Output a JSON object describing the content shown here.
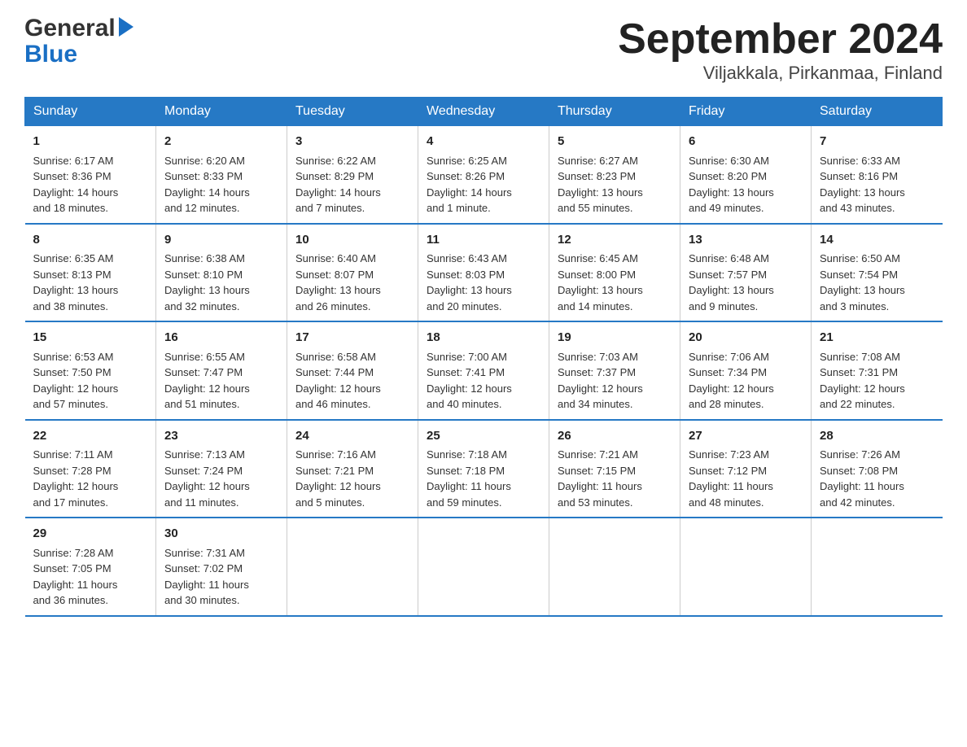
{
  "logo": {
    "part1": "General",
    "part2": "Blue"
  },
  "title": "September 2024",
  "subtitle": "Viljakkala, Pirkanmaa, Finland",
  "days": [
    "Sunday",
    "Monday",
    "Tuesday",
    "Wednesday",
    "Thursday",
    "Friday",
    "Saturday"
  ],
  "weeks": [
    [
      {
        "num": "1",
        "info": "Sunrise: 6:17 AM\nSunset: 8:36 PM\nDaylight: 14 hours\nand 18 minutes."
      },
      {
        "num": "2",
        "info": "Sunrise: 6:20 AM\nSunset: 8:33 PM\nDaylight: 14 hours\nand 12 minutes."
      },
      {
        "num": "3",
        "info": "Sunrise: 6:22 AM\nSunset: 8:29 PM\nDaylight: 14 hours\nand 7 minutes."
      },
      {
        "num": "4",
        "info": "Sunrise: 6:25 AM\nSunset: 8:26 PM\nDaylight: 14 hours\nand 1 minute."
      },
      {
        "num": "5",
        "info": "Sunrise: 6:27 AM\nSunset: 8:23 PM\nDaylight: 13 hours\nand 55 minutes."
      },
      {
        "num": "6",
        "info": "Sunrise: 6:30 AM\nSunset: 8:20 PM\nDaylight: 13 hours\nand 49 minutes."
      },
      {
        "num": "7",
        "info": "Sunrise: 6:33 AM\nSunset: 8:16 PM\nDaylight: 13 hours\nand 43 minutes."
      }
    ],
    [
      {
        "num": "8",
        "info": "Sunrise: 6:35 AM\nSunset: 8:13 PM\nDaylight: 13 hours\nand 38 minutes."
      },
      {
        "num": "9",
        "info": "Sunrise: 6:38 AM\nSunset: 8:10 PM\nDaylight: 13 hours\nand 32 minutes."
      },
      {
        "num": "10",
        "info": "Sunrise: 6:40 AM\nSunset: 8:07 PM\nDaylight: 13 hours\nand 26 minutes."
      },
      {
        "num": "11",
        "info": "Sunrise: 6:43 AM\nSunset: 8:03 PM\nDaylight: 13 hours\nand 20 minutes."
      },
      {
        "num": "12",
        "info": "Sunrise: 6:45 AM\nSunset: 8:00 PM\nDaylight: 13 hours\nand 14 minutes."
      },
      {
        "num": "13",
        "info": "Sunrise: 6:48 AM\nSunset: 7:57 PM\nDaylight: 13 hours\nand 9 minutes."
      },
      {
        "num": "14",
        "info": "Sunrise: 6:50 AM\nSunset: 7:54 PM\nDaylight: 13 hours\nand 3 minutes."
      }
    ],
    [
      {
        "num": "15",
        "info": "Sunrise: 6:53 AM\nSunset: 7:50 PM\nDaylight: 12 hours\nand 57 minutes."
      },
      {
        "num": "16",
        "info": "Sunrise: 6:55 AM\nSunset: 7:47 PM\nDaylight: 12 hours\nand 51 minutes."
      },
      {
        "num": "17",
        "info": "Sunrise: 6:58 AM\nSunset: 7:44 PM\nDaylight: 12 hours\nand 46 minutes."
      },
      {
        "num": "18",
        "info": "Sunrise: 7:00 AM\nSunset: 7:41 PM\nDaylight: 12 hours\nand 40 minutes."
      },
      {
        "num": "19",
        "info": "Sunrise: 7:03 AM\nSunset: 7:37 PM\nDaylight: 12 hours\nand 34 minutes."
      },
      {
        "num": "20",
        "info": "Sunrise: 7:06 AM\nSunset: 7:34 PM\nDaylight: 12 hours\nand 28 minutes."
      },
      {
        "num": "21",
        "info": "Sunrise: 7:08 AM\nSunset: 7:31 PM\nDaylight: 12 hours\nand 22 minutes."
      }
    ],
    [
      {
        "num": "22",
        "info": "Sunrise: 7:11 AM\nSunset: 7:28 PM\nDaylight: 12 hours\nand 17 minutes."
      },
      {
        "num": "23",
        "info": "Sunrise: 7:13 AM\nSunset: 7:24 PM\nDaylight: 12 hours\nand 11 minutes."
      },
      {
        "num": "24",
        "info": "Sunrise: 7:16 AM\nSunset: 7:21 PM\nDaylight: 12 hours\nand 5 minutes."
      },
      {
        "num": "25",
        "info": "Sunrise: 7:18 AM\nSunset: 7:18 PM\nDaylight: 11 hours\nand 59 minutes."
      },
      {
        "num": "26",
        "info": "Sunrise: 7:21 AM\nSunset: 7:15 PM\nDaylight: 11 hours\nand 53 minutes."
      },
      {
        "num": "27",
        "info": "Sunrise: 7:23 AM\nSunset: 7:12 PM\nDaylight: 11 hours\nand 48 minutes."
      },
      {
        "num": "28",
        "info": "Sunrise: 7:26 AM\nSunset: 7:08 PM\nDaylight: 11 hours\nand 42 minutes."
      }
    ],
    [
      {
        "num": "29",
        "info": "Sunrise: 7:28 AM\nSunset: 7:05 PM\nDaylight: 11 hours\nand 36 minutes."
      },
      {
        "num": "30",
        "info": "Sunrise: 7:31 AM\nSunset: 7:02 PM\nDaylight: 11 hours\nand 30 minutes."
      },
      {
        "num": "",
        "info": ""
      },
      {
        "num": "",
        "info": ""
      },
      {
        "num": "",
        "info": ""
      },
      {
        "num": "",
        "info": ""
      },
      {
        "num": "",
        "info": ""
      }
    ]
  ]
}
